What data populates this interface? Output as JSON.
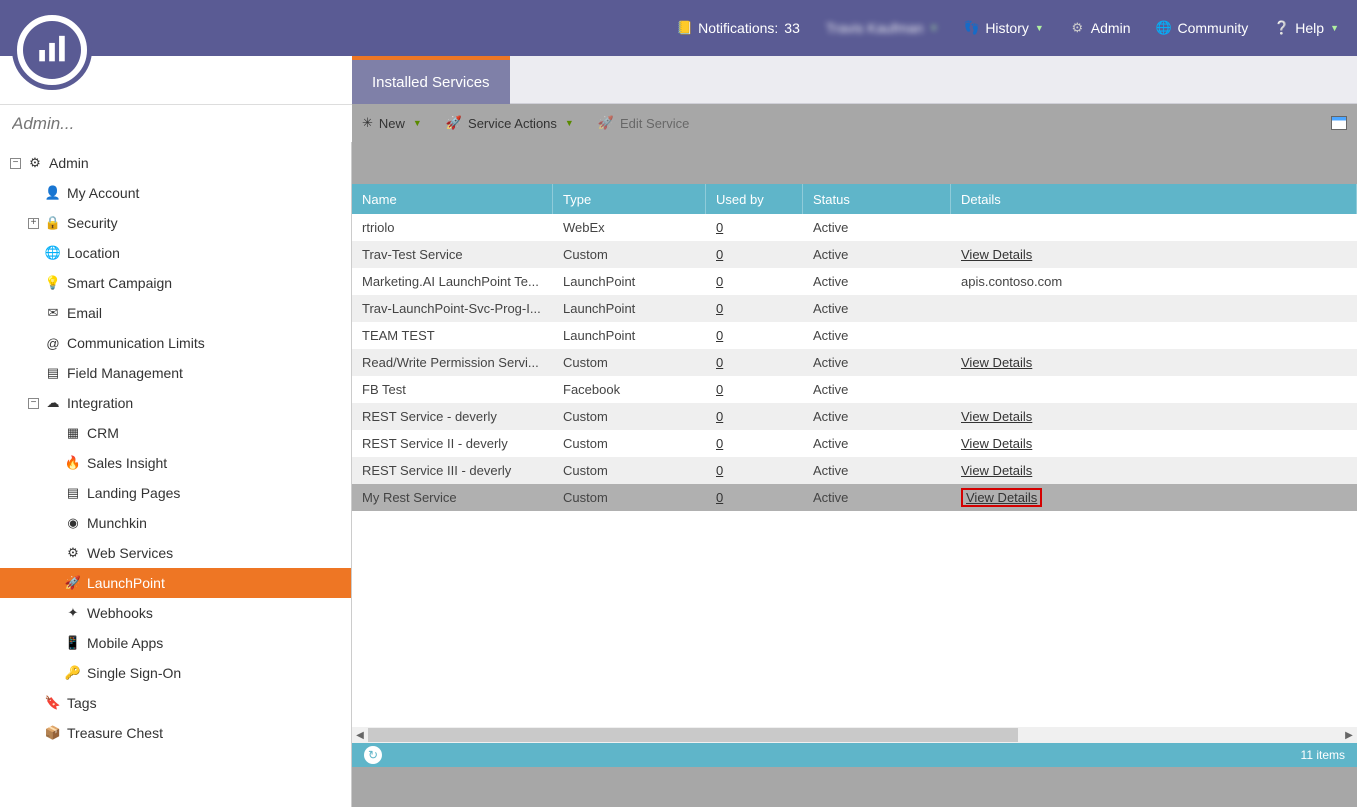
{
  "header": {
    "notifications": {
      "label": "Notifications:",
      "count": "33"
    },
    "user": "Travis Kaufman",
    "history": "History",
    "admin": "Admin",
    "community": "Community",
    "help": "Help"
  },
  "tabs": {
    "installed": "Installed Services"
  },
  "toolbar": {
    "new": "New",
    "actions": "Service Actions",
    "edit": "Edit Service"
  },
  "search": {
    "placeholder": "Admin..."
  },
  "sidebar": {
    "root": "Admin",
    "items": [
      {
        "label": "My Account",
        "icon": "👤"
      },
      {
        "label": "Security",
        "icon": "🔒",
        "expandable": true
      },
      {
        "label": "Location",
        "icon": "🌐"
      },
      {
        "label": "Smart Campaign",
        "icon": "💡"
      },
      {
        "label": "Email",
        "icon": "✉"
      },
      {
        "label": "Communication Limits",
        "icon": "@"
      },
      {
        "label": "Field Management",
        "icon": "▤"
      },
      {
        "label": "Integration",
        "icon": "☁",
        "expandable": true,
        "expanded": true,
        "children": [
          {
            "label": "CRM",
            "icon": "▦"
          },
          {
            "label": "Sales Insight",
            "icon": "🔥"
          },
          {
            "label": "Landing Pages",
            "icon": "▤"
          },
          {
            "label": "Munchkin",
            "icon": "◉"
          },
          {
            "label": "Web Services",
            "icon": "⚙"
          },
          {
            "label": "LaunchPoint",
            "icon": "🚀",
            "selected": true
          },
          {
            "label": "Webhooks",
            "icon": "✦"
          },
          {
            "label": "Mobile Apps",
            "icon": "📱"
          },
          {
            "label": "Single Sign-On",
            "icon": "🔑"
          }
        ]
      },
      {
        "label": "Tags",
        "icon": "🔖"
      },
      {
        "label": "Treasure Chest",
        "icon": "📦"
      }
    ]
  },
  "grid": {
    "columns": {
      "name": "Name",
      "type": "Type",
      "used": "Used by",
      "status": "Status",
      "details": "Details"
    },
    "rows": [
      {
        "name": "rtriolo",
        "type": "WebEx",
        "used": "0",
        "status": "Active",
        "details": ""
      },
      {
        "name": "Trav-Test Service",
        "type": "Custom",
        "used": "0",
        "status": "Active",
        "details": "View Details",
        "link": true
      },
      {
        "name": "Marketing.AI LaunchPoint Te...",
        "type": "LaunchPoint",
        "used": "0",
        "status": "Active",
        "details": "apis.contoso.com"
      },
      {
        "name": "Trav-LaunchPoint-Svc-Prog-I...",
        "type": "LaunchPoint",
        "used": "0",
        "status": "Active",
        "details": ""
      },
      {
        "name": "TEAM TEST",
        "type": "LaunchPoint",
        "used": "0",
        "status": "Active",
        "details": ""
      },
      {
        "name": "Read/Write Permission Servi...",
        "type": "Custom",
        "used": "0",
        "status": "Active",
        "details": "View Details",
        "link": true
      },
      {
        "name": "FB Test",
        "type": "Facebook",
        "used": "0",
        "status": "Active",
        "details": ""
      },
      {
        "name": "REST Service - deverly",
        "type": "Custom",
        "used": "0",
        "status": "Active",
        "details": "View Details",
        "link": true
      },
      {
        "name": "REST Service II - deverly",
        "type": "Custom",
        "used": "0",
        "status": "Active",
        "details": "View Details",
        "link": true
      },
      {
        "name": "REST Service III - deverly",
        "type": "Custom",
        "used": "0",
        "status": "Active",
        "details": "View Details",
        "link": true
      },
      {
        "name": "My Rest Service",
        "type": "Custom",
        "used": "0",
        "status": "Active",
        "details": "View Details",
        "link": true,
        "selected": true,
        "highlight": true
      }
    ]
  },
  "footer": {
    "count": "11 items"
  }
}
